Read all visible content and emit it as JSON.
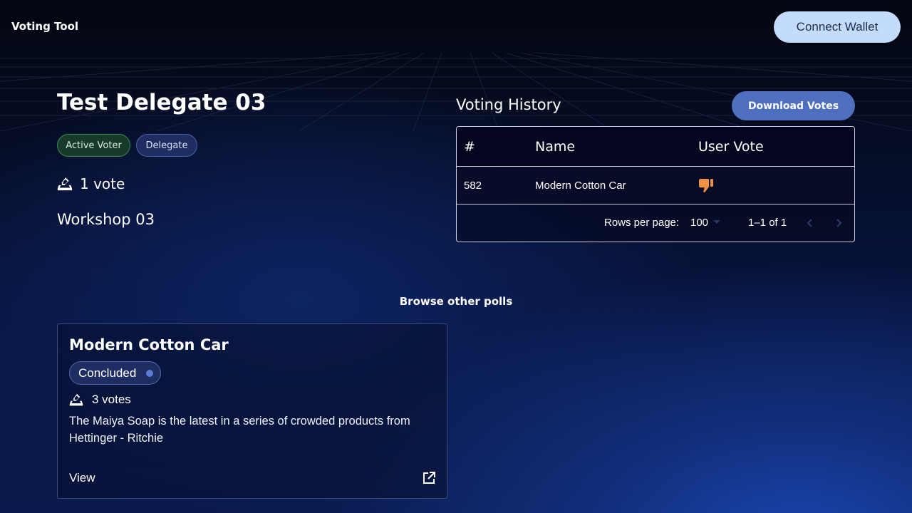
{
  "header": {
    "brand": "Voting Tool",
    "connect_label": "Connect Wallet"
  },
  "profile": {
    "name": "Test Delegate 03",
    "chips": [
      "Active Voter",
      "Delegate"
    ],
    "votes_text": "1 vote",
    "workshop": "Workshop 03"
  },
  "history": {
    "title": "Voting History",
    "download_label": "Download Votes",
    "columns": [
      "#",
      "Name",
      "User Vote"
    ],
    "rows": [
      {
        "id": "582",
        "name": "Modern Cotton Car",
        "vote_icon": "thumbs-down-icon"
      }
    ],
    "rows_per_page_label": "Rows per page:",
    "rows_per_page_value": "100",
    "range_text": "1–1 of 1"
  },
  "browse": {
    "heading": "Browse other polls",
    "polls": [
      {
        "title": "Modern Cotton Car",
        "status": "Concluded",
        "votes_text": "3 votes",
        "description": "The Maiya Soap is the latest in a series of crowded products from Hettinger - Ritchie",
        "view_label": "View"
      }
    ]
  },
  "colors": {
    "accent_button": "#4f70c0",
    "connect_button": "#c4dcfb",
    "thumbs_down": "#f0914a",
    "active_chip": "#173a2a",
    "delegate_chip": "#1e2e63"
  }
}
